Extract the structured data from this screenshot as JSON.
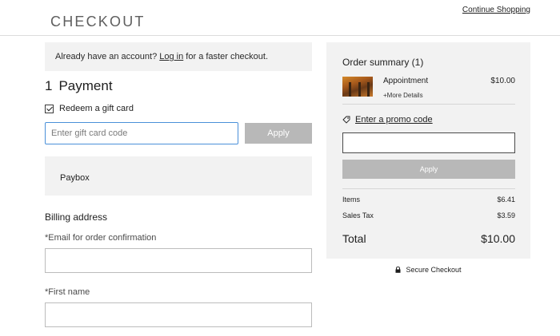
{
  "header": {
    "brand": "CHECKOUT",
    "continue_link": "Continue Shopping"
  },
  "login_prompt": {
    "prefix": "Already have an account? ",
    "link": "Log in",
    "suffix": " for a faster checkout."
  },
  "payment_step": {
    "number": "1",
    "title": "Payment"
  },
  "gift_card": {
    "checkbox_label": "Redeem a gift card",
    "checked": true,
    "placeholder": "Enter gift card code",
    "value": "",
    "apply_label": "Apply"
  },
  "payment_method": {
    "label": "Paybox"
  },
  "billing": {
    "title": "Billing address",
    "email_label": "*Email for order confirmation",
    "email_value": "",
    "first_name_label": "*First name",
    "first_name_value": ""
  },
  "summary": {
    "title": "Order summary (1)",
    "item": {
      "name": "Appointment",
      "price": "$10.00",
      "more_details": "+More Details"
    },
    "promo": {
      "link": "Enter a promo code",
      "value": "",
      "apply_label": "Apply"
    },
    "rows": [
      {
        "label": "Items",
        "value": "$6.41"
      },
      {
        "label": "Sales Tax",
        "value": "$3.59"
      }
    ],
    "total_label": "Total",
    "total_value": "$10.00"
  },
  "secure_text": "Secure Checkout",
  "colors": {
    "panel_bg": "#f2f2f2",
    "button_disabled": "#b8b8b8",
    "focus_border": "#4a90d9",
    "text": "#1e1e1e"
  },
  "icons": {
    "checkbox": "checkmark-icon",
    "promo": "tag-icon",
    "secure": "lock-icon"
  }
}
